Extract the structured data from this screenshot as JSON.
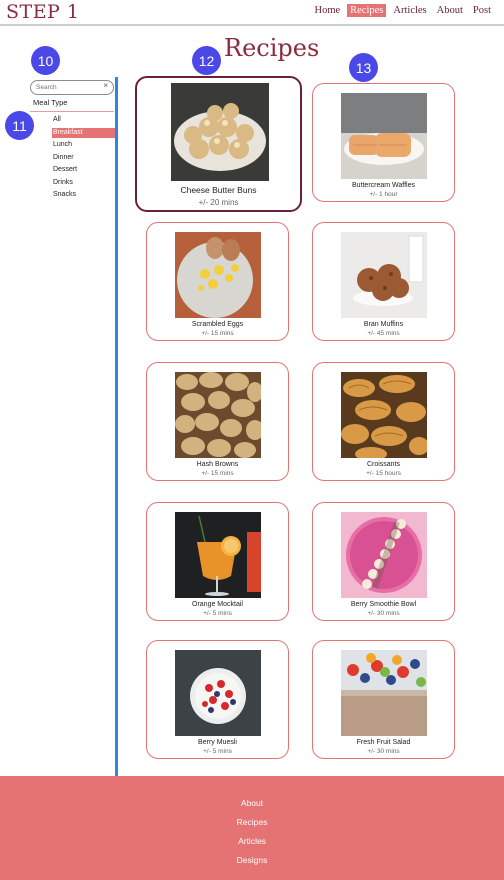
{
  "header": {
    "logo": "STEP 1",
    "nav": [
      {
        "label": "Home",
        "active": false
      },
      {
        "label": "Recipes",
        "active": true
      },
      {
        "label": "Articles",
        "active": false
      },
      {
        "label": "About",
        "active": false
      },
      {
        "label": "Post",
        "active": false
      }
    ]
  },
  "page": {
    "title": "Recipes"
  },
  "badges": {
    "b10": "10",
    "b11": "11",
    "b12": "12",
    "b13": "13"
  },
  "sidebar": {
    "search_placeholder": "Search",
    "clear_glyph": "×",
    "meal_type_label": "Meal Type",
    "filters": [
      {
        "label": "All",
        "active": false
      },
      {
        "label": "Breakfast",
        "active": true
      },
      {
        "label": "Lunch",
        "active": false
      },
      {
        "label": "Dinner",
        "active": false
      },
      {
        "label": "Dessert",
        "active": false
      },
      {
        "label": "Drinks",
        "active": false
      },
      {
        "label": "Snacks",
        "active": false
      }
    ]
  },
  "recipes": [
    {
      "name": "Cheese Butter Buns",
      "time": "+/- 20 mins",
      "image": "buns-icon"
    },
    {
      "name": "Buttercream Waffles",
      "time": "+/- 1 hour",
      "image": "waffles-icon"
    },
    {
      "name": "Scrambled Eggs",
      "time": "+/- 15 mins",
      "image": "eggs-icon"
    },
    {
      "name": "Bran Muffins",
      "time": "+/- 45 mins",
      "image": "muffins-icon"
    },
    {
      "name": "Hash Browns",
      "time": "+/- 15 mins",
      "image": "potatoes-icon"
    },
    {
      "name": "Croissants",
      "time": "+/- 15 hours",
      "image": "croissants-icon"
    },
    {
      "name": "Orange Mocktail",
      "time": "+/- 5 mins",
      "image": "mocktail-icon"
    },
    {
      "name": "Berry Smoothie Bowl",
      "time": "+/- 30 mins",
      "image": "smoothie-bowl-icon"
    },
    {
      "name": "Berry Muesli",
      "time": "+/- 5 mins",
      "image": "muesli-icon"
    },
    {
      "name": "Fresh Fruit Salad",
      "time": "+/- 30 mins",
      "image": "fruit-salad-icon"
    }
  ],
  "footer": {
    "links": [
      "About",
      "Recipes",
      "Articles",
      "Designs"
    ]
  },
  "colors": {
    "accent": "#e57373",
    "brand": "#8a2b3e",
    "badge": "#4a48e6",
    "divider": "#2e86de"
  }
}
